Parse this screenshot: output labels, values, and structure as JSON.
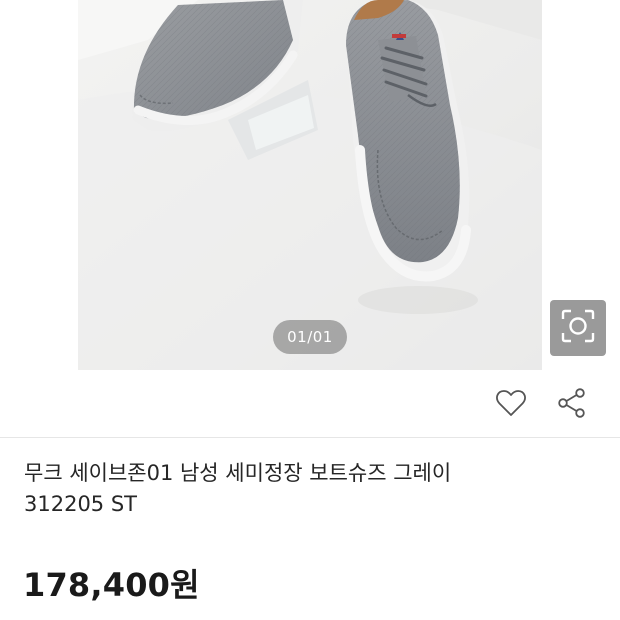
{
  "gallery": {
    "page_indicator": "01/01",
    "lens_icon": "image-search-icon"
  },
  "actions": {
    "like_icon": "heart-icon",
    "share_icon": "share-icon"
  },
  "product": {
    "title_line1": "무크 세이브존01 남성 세미정장 보트슈즈 그레이",
    "title_line2": "312205 ST",
    "price": "178,400원"
  },
  "colors": {
    "shoe": "#8c8f93",
    "sole": "#f2f2f2",
    "background": "#ffffff",
    "overlay": "#6e6e6e"
  }
}
